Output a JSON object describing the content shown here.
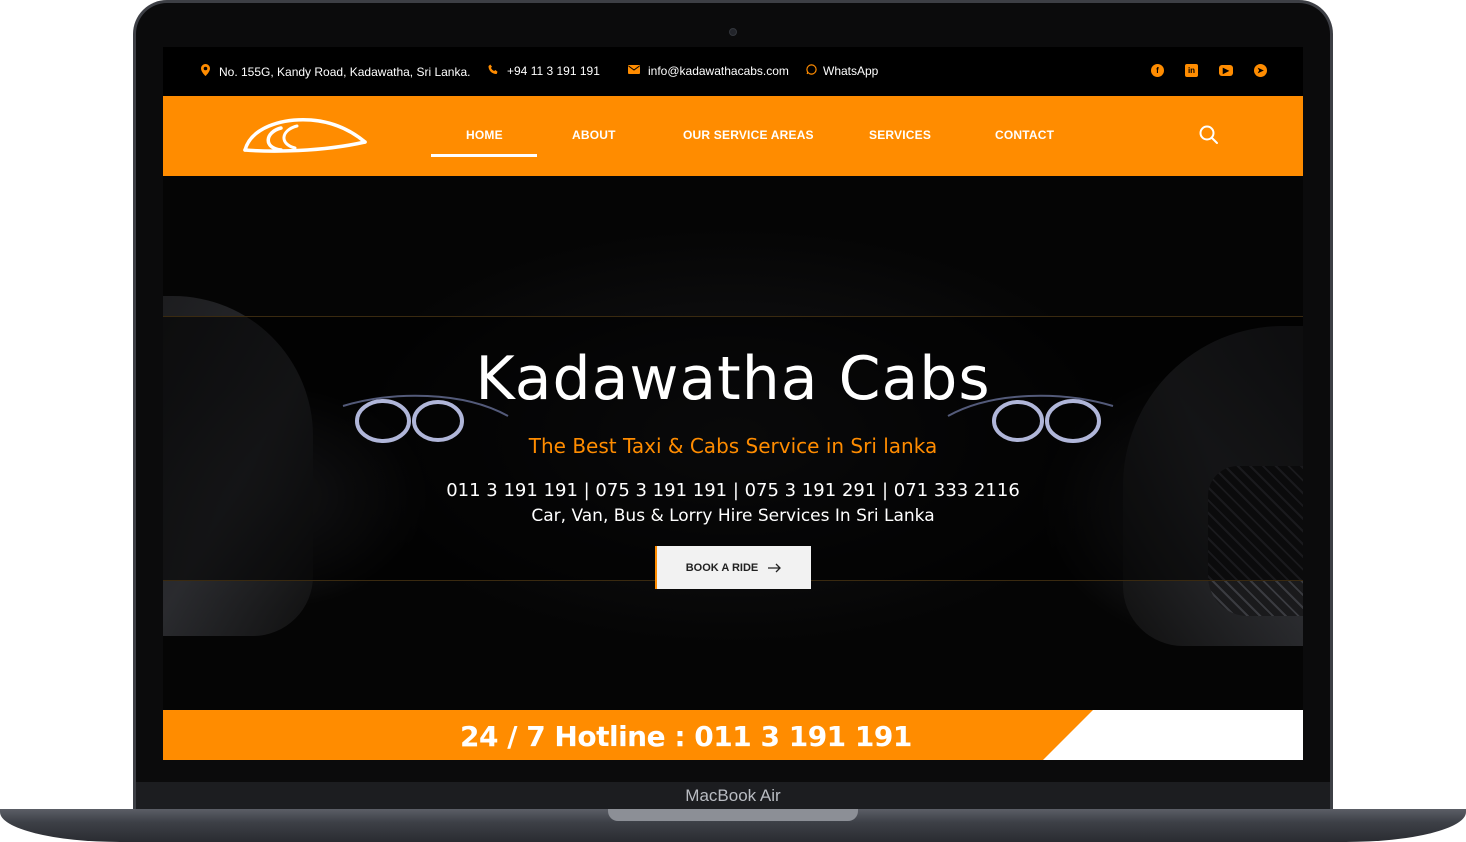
{
  "topbar": {
    "address": "No. 155G, Kandy Road, Kadawatha, Sri Lanka.",
    "phone": "+94 11 3 191 191",
    "email": "info@kadawathacabs.com",
    "whatsapp": "WhatsApp",
    "social_icons": [
      "facebook-icon",
      "linkedin-icon",
      "youtube-icon",
      "telegram-icon"
    ]
  },
  "nav": {
    "items": [
      "HOME",
      "ABOUT",
      "OUR SERVICE AREAS",
      "SERVICES",
      "CONTACT"
    ],
    "active": "HOME"
  },
  "hero": {
    "title": "Kadawatha Cabs",
    "subtitle": "The Best Taxi & Cabs Service in Sri lanka",
    "phones": "011 3 191 191 | 075 3 191 191 | 075 3 191 291 | 071 333 2116",
    "services": "Car, Van, Bus & Lorry Hire Services In Sri Lanka",
    "cta": "BOOK A RIDE"
  },
  "hotline": "24 / 7 Hotline : 011 3 191 191",
  "device_label": "MacBook Air",
  "colors": {
    "accent": "#ff8c00",
    "background": "#000000",
    "text": "#ffffff"
  }
}
